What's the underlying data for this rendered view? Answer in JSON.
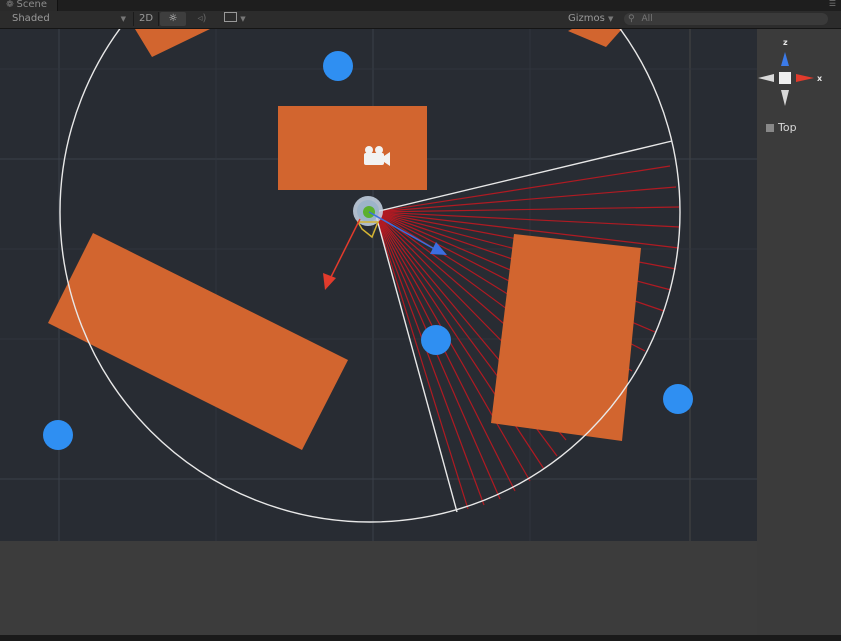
{
  "window": {
    "tab_title": "Scene",
    "tab_icon": "scene-icon",
    "menu_icon": "panel-menu-icon"
  },
  "toolbar": {
    "draw_mode": "Shaded",
    "mode_2d": "2D",
    "lighting_icon": "sun-icon",
    "audio_icon": "speaker-icon",
    "effects_icon": "image-icon",
    "gizmos_label": "Gizmos",
    "search_placeholder": "All"
  },
  "orientation_gizmo": {
    "axis_z": "z",
    "axis_x": "x",
    "view_label": "Top",
    "colors": {
      "z": "#3b7ae8",
      "x": "#e23b2c",
      "y": "#d9d9d9"
    }
  },
  "scene": {
    "colors": {
      "background": "#282c33",
      "grid": "#3a404a",
      "obstacle": "#d2652f",
      "target": "#2f8ff2",
      "view_radius": "#e8e8e8",
      "view_rays": "#b81a22",
      "forward_arrow": "#3b6ee0",
      "right_arrow": "#e23b2c"
    },
    "field_of_view_ray_count": 24
  }
}
